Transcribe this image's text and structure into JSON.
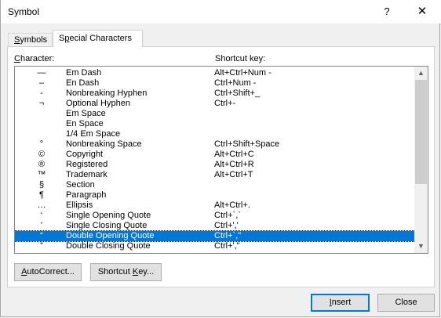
{
  "window": {
    "title": "Symbol",
    "help_label": "?",
    "close_glyph": "✕"
  },
  "tabs": [
    {
      "label_u": "S",
      "label_rest": "ymbols"
    },
    {
      "label_pre": "S",
      "label_u": "p",
      "label_rest": "ecial Characters"
    }
  ],
  "headers": {
    "character_u": "C",
    "character_rest": "haracter:",
    "shortcut": "Shortcut key:"
  },
  "rows": [
    {
      "char": "—",
      "name": "Em Dash",
      "key": "Alt+Ctrl+Num -"
    },
    {
      "char": "–",
      "name": "En Dash",
      "key": "Ctrl+Num -"
    },
    {
      "char": "-",
      "name": "Nonbreaking Hyphen",
      "key": "Ctrl+Shift+_"
    },
    {
      "char": "¬",
      "name": "Optional Hyphen",
      "key": "Ctrl+-"
    },
    {
      "char": "",
      "name": "Em Space",
      "key": ""
    },
    {
      "char": "",
      "name": "En Space",
      "key": ""
    },
    {
      "char": "",
      "name": "1/4 Em Space",
      "key": ""
    },
    {
      "char": "°",
      "name": "Nonbreaking Space",
      "key": "Ctrl+Shift+Space"
    },
    {
      "char": "©",
      "name": "Copyright",
      "key": "Alt+Ctrl+C"
    },
    {
      "char": "®",
      "name": "Registered",
      "key": "Alt+Ctrl+R"
    },
    {
      "char": "™",
      "name": "Trademark",
      "key": "Alt+Ctrl+T"
    },
    {
      "char": "§",
      "name": "Section",
      "key": ""
    },
    {
      "char": "¶",
      "name": "Paragraph",
      "key": ""
    },
    {
      "char": "…",
      "name": "Ellipsis",
      "key": "Alt+Ctrl+."
    },
    {
      "char": "‘",
      "name": "Single Opening Quote",
      "key": "Ctrl+`,`"
    },
    {
      "char": "’",
      "name": "Single Closing Quote",
      "key": "Ctrl+','"
    },
    {
      "char": "“",
      "name": "Double Opening Quote",
      "key": "Ctrl+`,\""
    },
    {
      "char": "”",
      "name": "Double Closing Quote",
      "key": "Ctrl+',\""
    }
  ],
  "selected_row": "Double Opening Quote",
  "scrollbar": {
    "up_glyph": "▲",
    "down_glyph": "▼"
  },
  "buttons": {
    "autocorrect_u": "A",
    "autocorrect_rest": "utoCorrect...",
    "shortcut_pre": "Shortcut ",
    "shortcut_u": "K",
    "shortcut_rest": "ey...",
    "insert_u": "I",
    "insert_rest": "nsert",
    "close": "Close"
  },
  "colors": {
    "selection": "#0078d7",
    "default_button_border": "#0078d7"
  }
}
